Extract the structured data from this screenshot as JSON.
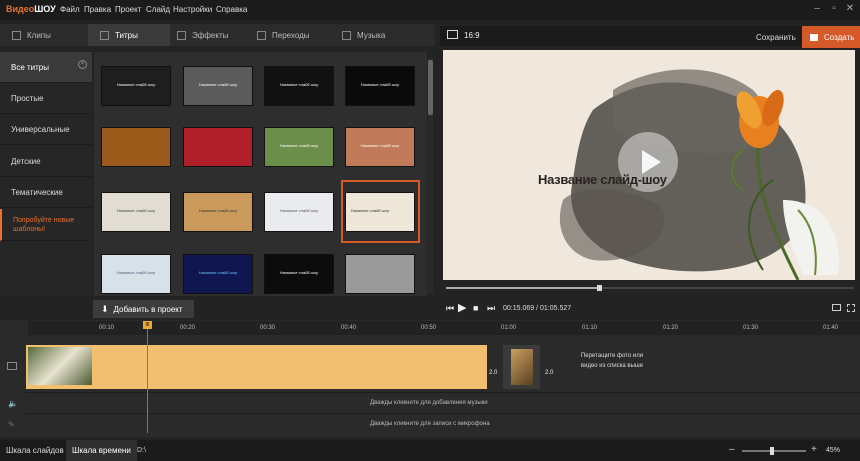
{
  "app": {
    "logo_prefix": "Видео",
    "logo_suffix": "ШОУ"
  },
  "menu": [
    "Файл",
    "Правка",
    "Проект",
    "Слайд",
    "Настройки",
    "Справка"
  ],
  "window_controls": [
    "–",
    "▫",
    "✕"
  ],
  "tabs": [
    {
      "label": "Клипы"
    },
    {
      "label": "Титры"
    },
    {
      "label": "Эффекты"
    },
    {
      "label": "Переходы"
    },
    {
      "label": "Музыка"
    }
  ],
  "categories": [
    {
      "label": "Все титры"
    },
    {
      "label": "Простые"
    },
    {
      "label": "Универсальные"
    },
    {
      "label": "Детские"
    },
    {
      "label": "Тематические"
    },
    {
      "label": "Попробуйте новые шаблоны!"
    }
  ],
  "category_close": "×",
  "thumbs": [
    {
      "bg": "#1e1e1e",
      "text": "Название слайд-шоу"
    },
    {
      "bg": "#5b5b5b",
      "text": "Название слайд-шоу"
    },
    {
      "bg": "#111111",
      "text": "Название слайд-шоу"
    },
    {
      "bg": "#0a0a0a",
      "text": "Название слайд-шоу"
    },
    {
      "bg": "#9b5a1a",
      "text": ""
    },
    {
      "bg": "#b0202a",
      "text": ""
    },
    {
      "bg": "#6b8e4a",
      "text": "Название слайд-шоу"
    },
    {
      "bg": "#c07a5a",
      "text": "Название слайд-шоу"
    },
    {
      "bg": "#e2ddd3",
      "text": "Название слайд-шоу"
    },
    {
      "bg": "#c99a5c",
      "text": "Название слайд-шоу"
    },
    {
      "bg": "#e9ebee",
      "text": "Название слайд-шоу"
    },
    {
      "bg": "#efe6da",
      "text": "Название слайд-шоу"
    },
    {
      "bg": "#d7e2e8",
      "text": "Название слайд-шоу"
    },
    {
      "bg": "#101650",
      "text": "Название слайд-шоу"
    },
    {
      "bg": "#0c0c0c",
      "text": "Название слайд-шоу"
    },
    {
      "bg": "#9a9a9a",
      "text": ""
    }
  ],
  "add_to_project": "Добавить в проект",
  "preview": {
    "ratio": "16:9",
    "save": "Сохранить",
    "create": "Создать",
    "title": "Название слайд-шоу",
    "timecode": "00:15.069 / 01:05.527",
    "progress": 0.375
  },
  "ruler_ticks": [
    "00:10",
    "00:20",
    "00:30",
    "00:40",
    "00:50",
    "01:00",
    "01:10",
    "01:20",
    "01:30",
    "01:40"
  ],
  "playhead_label": "III",
  "clip1_duration": "2.0",
  "clip2_duration": "2.0",
  "drop_hint": "Перетащите фото или видео из списка выше",
  "music_hint": "Дважды кликните для добавления музыки",
  "mic_hint": "Дважды кликните для записи с микрофона",
  "bottom": {
    "slides_tab": "Шкала слайдов",
    "timeline_tab": "Шкала времени",
    "disk": "D:\\",
    "zoom_minus": "–",
    "zoom_plus": "+",
    "zoom": "45%"
  },
  "colors": {
    "accent": "#d55a2a",
    "track": "#f0c070"
  }
}
